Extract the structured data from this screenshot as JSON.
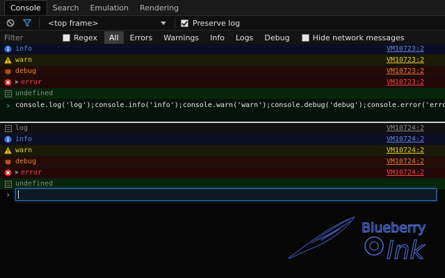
{
  "tabs": [
    {
      "label": "Console",
      "active": true
    },
    {
      "label": "Search",
      "active": false
    },
    {
      "label": "Emulation",
      "active": false
    },
    {
      "label": "Rendering",
      "active": false
    }
  ],
  "toolbar": {
    "clear_icon": "no-entry-icon",
    "filter_icon": "funnel-icon",
    "frame_selected": "<top frame>",
    "preserve_log_label": "Preserve log",
    "preserve_log_checked": true
  },
  "filterbar": {
    "filter_placeholder": "Filter",
    "regex_label": "Regex",
    "regex_checked": false,
    "levels": [
      "All",
      "Errors",
      "Warnings",
      "Info",
      "Logs",
      "Debug"
    ],
    "active_level": "All",
    "hide_network_label": "Hide network messages",
    "hide_network_checked": false
  },
  "messages": [
    {
      "type": "info",
      "icon": "info-icon",
      "text": "info",
      "source": "VM10723:2"
    },
    {
      "type": "warn",
      "icon": "warning-icon",
      "text": "warn",
      "source": "VM10723:2"
    },
    {
      "type": "debug",
      "icon": "bug-icon",
      "text": "debug",
      "source": "VM10723:2"
    },
    {
      "type": "error",
      "icon": "error-icon",
      "text": "error",
      "source": "VM10723:2",
      "expandable": true
    },
    {
      "type": "result",
      "icon": "result-icon",
      "text": "undefined"
    },
    {
      "type": "command",
      "icon": "prompt-chevron-icon",
      "text": "console.log('log');console.info('info');console.warn('warn');console.debug('debug');console.error('error')"
    },
    {
      "type": "log",
      "icon": "log-icon",
      "text": "log",
      "source": "VM10724:2"
    },
    {
      "type": "info",
      "icon": "info-icon",
      "text": "info",
      "source": "VM10724:2"
    },
    {
      "type": "warn",
      "icon": "warning-icon",
      "text": "warn",
      "source": "VM10724:2"
    },
    {
      "type": "debug",
      "icon": "bug-icon",
      "text": "debug",
      "source": "VM10724:2"
    },
    {
      "type": "error",
      "icon": "error-icon",
      "text": "error",
      "source": "VM10724:2",
      "expandable": true
    },
    {
      "type": "result",
      "icon": "result-icon",
      "text": "undefined"
    }
  ],
  "prompt": {
    "value": ""
  },
  "watermark": {
    "brand_top": "Blueberry",
    "brand_bottom": "Ink"
  },
  "colors": {
    "info": "#5f86d8",
    "warn": "#e8d030",
    "debug": "#f07a30",
    "error": "#f04545",
    "result_bg": "#06260a",
    "accent": "#3b6db8"
  }
}
